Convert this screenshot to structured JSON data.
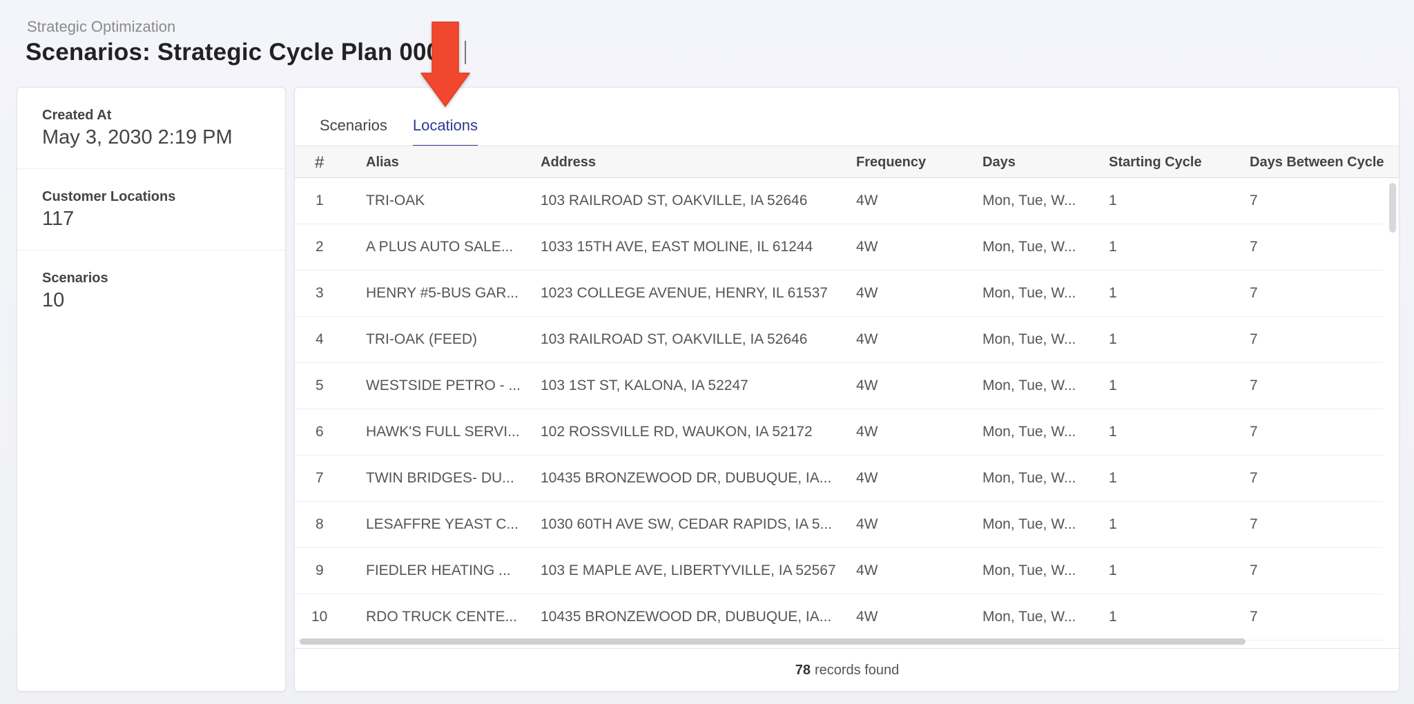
{
  "breadcrumb": "Strategic Optimization",
  "page_title": "Scenarios: Strategic Cycle Plan 0001",
  "summary": {
    "created_at_label": "Created At",
    "created_at_value": "May 3, 2030 2:19 PM",
    "customer_locations_label": "Customer Locations",
    "customer_locations_value": "117",
    "scenarios_label": "Scenarios",
    "scenarios_value": "10"
  },
  "tabs": [
    {
      "label": "Scenarios",
      "active": false
    },
    {
      "label": "Locations",
      "active": true
    }
  ],
  "table": {
    "columns": [
      "#",
      "Alias",
      "Address",
      "Frequency",
      "Days",
      "Starting Cycle",
      "Days Between Cycle"
    ],
    "rows": [
      [
        "1",
        "TRI-OAK",
        "103 RAILROAD ST, OAKVILLE, IA 52646",
        "4W",
        "Mon, Tue, W...",
        "1",
        "7"
      ],
      [
        "2",
        "A PLUS AUTO SALE...",
        "1033 15TH AVE, EAST MOLINE, IL 61244",
        "4W",
        "Mon, Tue, W...",
        "1",
        "7"
      ],
      [
        "3",
        "HENRY #5-BUS GAR...",
        "1023 COLLEGE AVENUE, HENRY, IL 61537",
        "4W",
        "Mon, Tue, W...",
        "1",
        "7"
      ],
      [
        "4",
        "TRI-OAK (FEED)",
        "103 RAILROAD ST, OAKVILLE, IA 52646",
        "4W",
        "Mon, Tue, W...",
        "1",
        "7"
      ],
      [
        "5",
        "WESTSIDE PETRO - ...",
        "103 1ST ST, KALONA, IA 52247",
        "4W",
        "Mon, Tue, W...",
        "1",
        "7"
      ],
      [
        "6",
        "HAWK'S FULL SERVI...",
        "102 ROSSVILLE RD, WAUKON, IA 52172",
        "4W",
        "Mon, Tue, W...",
        "1",
        "7"
      ],
      [
        "7",
        "TWIN BRIDGES- DU...",
        "10435 BRONZEWOOD DR, DUBUQUE, IA...",
        "4W",
        "Mon, Tue, W...",
        "1",
        "7"
      ],
      [
        "8",
        "LESAFFRE YEAST C...",
        "1030 60TH AVE SW, CEDAR RAPIDS, IA 5...",
        "4W",
        "Mon, Tue, W...",
        "1",
        "7"
      ],
      [
        "9",
        "FIEDLER HEATING ...",
        "103 E MAPLE AVE, LIBERTYVILLE, IA 52567",
        "4W",
        "Mon, Tue, W...",
        "1",
        "7"
      ],
      [
        "10",
        "RDO TRUCK CENTE...",
        "10435 BRONZEWOOD DR, DUBUQUE, IA...",
        "4W",
        "Mon, Tue, W...",
        "1",
        "7"
      ]
    ]
  },
  "footer": {
    "count": "78",
    "suffix": "records found"
  },
  "colors": {
    "accent": "#2c3a8c",
    "annotation_arrow": "#f0472f"
  },
  "icons": {
    "annotation": "down-arrow-icon"
  }
}
